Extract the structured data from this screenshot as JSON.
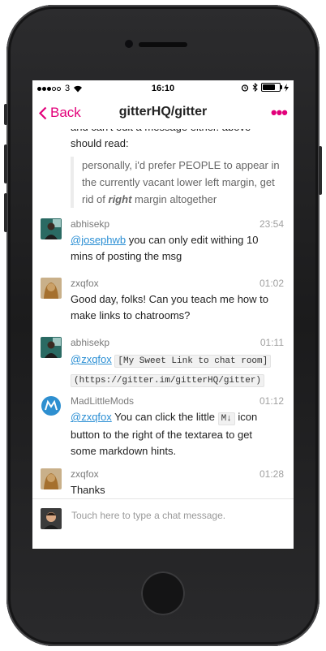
{
  "status": {
    "carrier": "3",
    "time": "16:10",
    "battery_fraction": 0.85
  },
  "nav": {
    "back_label": "Back",
    "title": "gitterHQ/gitter",
    "more_icon": "more-dots-icon"
  },
  "colors": {
    "accent": "#e2007a",
    "mention": "#2b8fd4"
  },
  "prev_message": {
    "cut_text": "and can't edit a message either. above",
    "text": "should read:",
    "quote_line1": "personally, i'd prefer PEOPLE to appear in",
    "quote_line2": "the currently vacant lower left margin, get",
    "quote_pre": "rid of ",
    "quote_em": "right",
    "quote_post": " margin altogether"
  },
  "messages": [
    {
      "user": "abhisekp",
      "time": "23:54",
      "mention": "@josephwb",
      "text": " you can only edit withing 10 mins of posting the msg"
    },
    {
      "user": "zxqfox",
      "time": "01:02",
      "text": "Good day, folks! Can you teach me how to make links to chatrooms?"
    },
    {
      "user": "abhisekp",
      "time": "01:11",
      "mention": "@zxqfox",
      "code1": "[My Sweet Link to chat room]",
      "code2": "(https://gitter.im/gitterHQ/gitter)"
    },
    {
      "user": "MadLittleMods",
      "time": "01:12",
      "mention": "@zxqfox",
      "pre": " You can click the little ",
      "code": "M↓",
      "post": " icon button to the right of the textarea to get some markdown hints."
    },
    {
      "user": "zxqfox",
      "time": "01:28",
      "text": "Thanks"
    }
  ],
  "composer": {
    "placeholder": "Touch here to type a chat message."
  }
}
